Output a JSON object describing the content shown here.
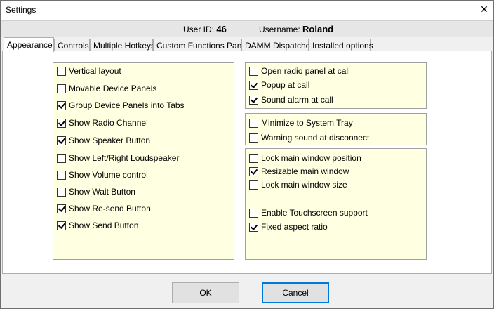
{
  "window": {
    "title": "Settings",
    "close_glyph": "✕"
  },
  "user": {
    "id_label": "User ID:",
    "id_value": "46",
    "name_label": "Username:",
    "name_value": "Roland"
  },
  "tabs": [
    {
      "label": "Appearance",
      "active": true
    },
    {
      "label": "Controls",
      "active": false
    },
    {
      "label": "Multiple Hotkeys",
      "active": false
    },
    {
      "label": "Custom Functions Panel",
      "active": false
    },
    {
      "label": "DAMM Dispatcher",
      "active": false
    },
    {
      "label": "Installed options",
      "active": false
    }
  ],
  "left_group": [
    {
      "label": "Vertical layout",
      "checked": false
    },
    {
      "label": "Movable Device Panels",
      "checked": false
    },
    {
      "label": "Group Device Panels into Tabs",
      "checked": true
    },
    {
      "label": "Show Radio Channel",
      "checked": true
    },
    {
      "label": "Show Speaker Button",
      "checked": true
    },
    {
      "label": "Show Left/Right Loudspeaker",
      "checked": false
    },
    {
      "label": "Show Volume control",
      "checked": false
    },
    {
      "label": "Show Wait Button",
      "checked": false
    },
    {
      "label": "Show Re-send Button",
      "checked": true
    },
    {
      "label": "Show Send Button",
      "checked": true
    }
  ],
  "right_group1": [
    {
      "label": "Open radio panel at call",
      "checked": false
    },
    {
      "label": "Popup at call",
      "checked": true
    },
    {
      "label": "Sound alarm at call",
      "checked": true
    }
  ],
  "right_group2": [
    {
      "label": "Minimize to System Tray",
      "checked": false
    },
    {
      "label": "Warning sound at disconnect",
      "checked": false
    }
  ],
  "right_group3": [
    {
      "label": "Lock main window position",
      "checked": false
    },
    {
      "label": "Resizable main window",
      "checked": true
    },
    {
      "label": "Lock main window size",
      "checked": false
    },
    {
      "label": "Enable Touchscreen support",
      "checked": false
    },
    {
      "label": "Fixed aspect ratio",
      "checked": true
    }
  ],
  "buttons": {
    "ok": "OK",
    "cancel": "Cancel"
  },
  "colors": {
    "panel_bg": "#ffffe1",
    "focus_border": "#0078d7"
  }
}
